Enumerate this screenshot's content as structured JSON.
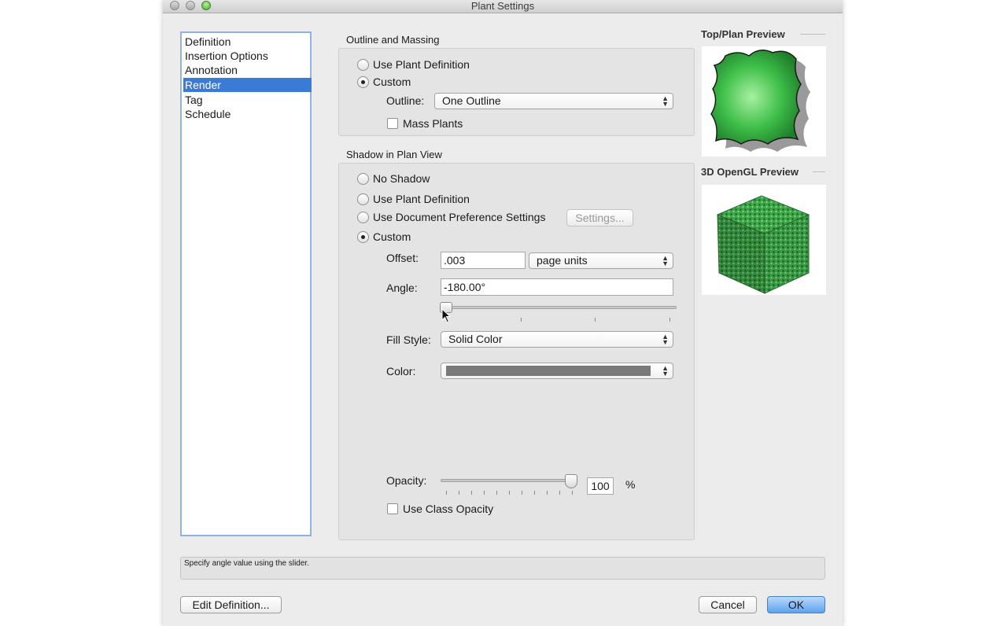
{
  "window": {
    "title": "Plant Settings"
  },
  "sidebar": {
    "items": [
      {
        "label": "Definition",
        "selected": false
      },
      {
        "label": "Insertion Options",
        "selected": false
      },
      {
        "label": "Annotation",
        "selected": false
      },
      {
        "label": "Render",
        "selected": true
      },
      {
        "label": "Tag",
        "selected": false
      },
      {
        "label": "Schedule",
        "selected": false
      }
    ]
  },
  "outline_massing": {
    "title": "Outline and Massing",
    "use_plant_definition": "Use Plant Definition",
    "custom": "Custom",
    "outline_label": "Outline:",
    "outline_value": "One Outline",
    "mass_plants": "Mass Plants"
  },
  "shadow": {
    "title": "Shadow in Plan View",
    "no_shadow": "No Shadow",
    "use_plant_definition": "Use Plant Definition",
    "use_doc_pref": "Use Document Preference Settings",
    "settings_button": "Settings...",
    "custom": "Custom",
    "offset_label": "Offset:",
    "offset_value": ".003",
    "offset_units": "page units",
    "angle_label": "Angle:",
    "angle_value": "-180.00°",
    "angle_slider_fraction": 0.0,
    "fill_style_label": "Fill Style:",
    "fill_style_value": "Solid Color",
    "color_label": "Color:",
    "color_value": "#7a7a7a",
    "opacity_label": "Opacity:",
    "opacity_value": "100",
    "opacity_unit": "%",
    "opacity_fraction": 1.0,
    "use_class_opacity": "Use Class Opacity"
  },
  "previews": {
    "top_plan": "Top/Plan Preview",
    "opengl": "3D OpenGL Preview"
  },
  "status": {
    "text": "Specify angle value using the slider."
  },
  "buttons": {
    "edit_definition": "Edit Definition...",
    "cancel": "Cancel",
    "ok": "OK"
  }
}
